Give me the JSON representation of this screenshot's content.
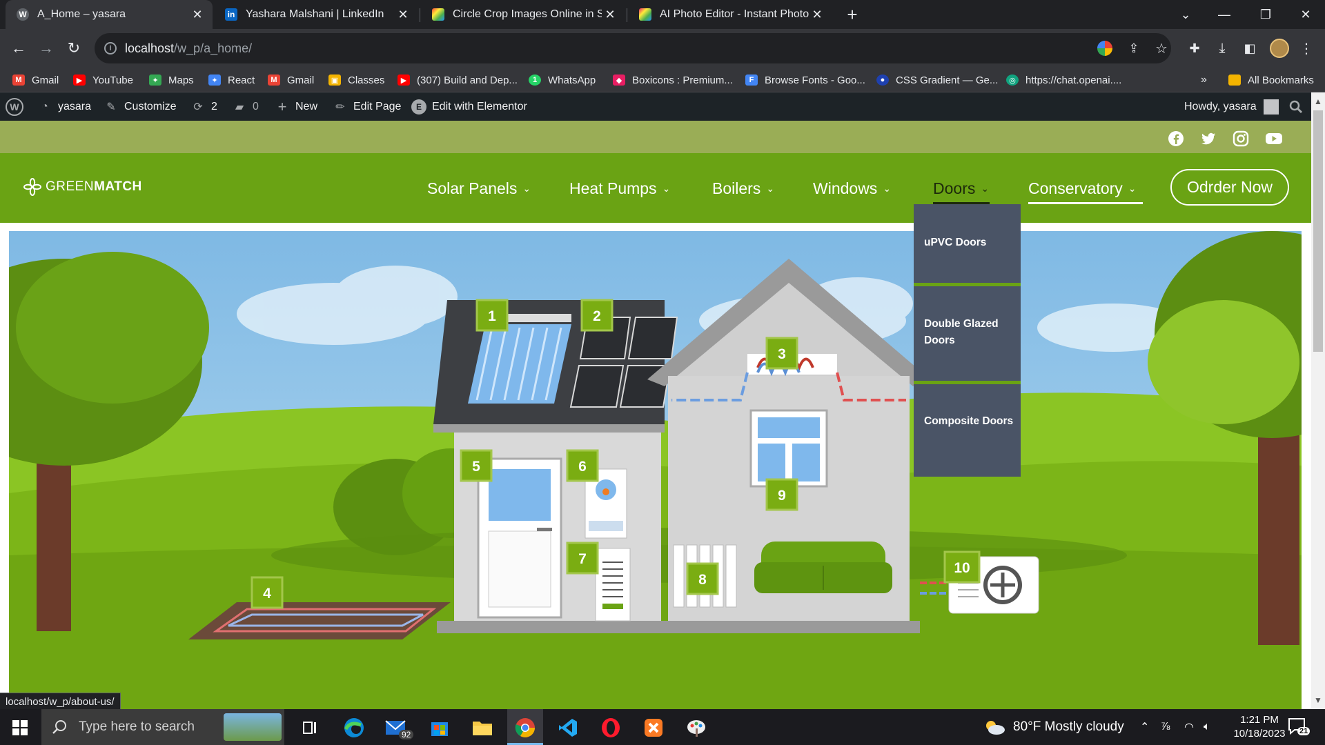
{
  "browser": {
    "tabs": [
      {
        "title": "A_Home – yasara",
        "active": true
      },
      {
        "title": "Yashara Malshani | LinkedIn",
        "active": false
      },
      {
        "title": "Circle Crop Images Online in Sec",
        "active": false
      },
      {
        "title": "AI Photo Editor - Instant Photo E",
        "active": false
      }
    ],
    "url_host": "localhost",
    "url_path": "/w_p/a_home/",
    "bookmarks": [
      {
        "label": "Gmail",
        "color": "#ea4335",
        "glyph": "M"
      },
      {
        "label": "YouTube",
        "color": "#ff0000",
        "glyph": "▶"
      },
      {
        "label": "Maps",
        "color": "#34a853",
        "glyph": "✦"
      },
      {
        "label": "React",
        "color": "#4285f4",
        "glyph": "✦"
      },
      {
        "label": "Gmail",
        "color": "#ea4335",
        "glyph": "M"
      },
      {
        "label": "Classes",
        "color": "#f4b400",
        "glyph": "▣"
      },
      {
        "label": "(307) Build and Dep...",
        "color": "#ff0000",
        "glyph": "▶"
      },
      {
        "label": "WhatsApp",
        "color": "#25d366",
        "glyph": "1"
      },
      {
        "label": "Boxicons : Premium...",
        "color": "#e91e63",
        "glyph": "◆"
      },
      {
        "label": "Browse Fonts - Goo...",
        "color": "#4285f4",
        "glyph": "F"
      },
      {
        "label": "CSS Gradient — Ge...",
        "color": "#1e40af",
        "glyph": "●"
      },
      {
        "label": "https://chat.openai....",
        "color": "#10a37f",
        "glyph": "◎"
      }
    ],
    "all_bookmarks": "All Bookmarks",
    "overflow": "»",
    "status_url": "localhost/w_p/about-us/"
  },
  "wp_admin": {
    "site": "yasara",
    "customize": "Customize",
    "updates": "2",
    "comments": "0",
    "new": "New",
    "edit_page": "Edit Page",
    "elementor": "Edit with Elementor",
    "howdy": "Howdy, yasara"
  },
  "site": {
    "logo_light": "GREEN",
    "logo_bold": "MATCH",
    "nav": [
      {
        "label": "Solar Panels"
      },
      {
        "label": "Heat Pumps"
      },
      {
        "label": "Boilers"
      },
      {
        "label": "Windows"
      },
      {
        "label": "Doors"
      },
      {
        "label": "Conservatory"
      }
    ],
    "cta": "Odrder Now",
    "doors_menu": [
      "uPVC Doors",
      "Double Glazed Doors",
      "Composite Doors"
    ],
    "hotspots": [
      "1",
      "2",
      "3",
      "4",
      "5",
      "6",
      "7",
      "8",
      "9",
      "10"
    ],
    "colors": {
      "header": "#6aa314",
      "topbar": "#9aad56",
      "dropdown": "#4a5466",
      "hotspot": "#7aad12"
    }
  },
  "taskbar": {
    "search_placeholder": "Type here to search",
    "mail_badge": "92",
    "weather": "80°F  Mostly cloudy",
    "time": "1:21 PM",
    "date": "10/18/2023",
    "notifications": "21"
  }
}
